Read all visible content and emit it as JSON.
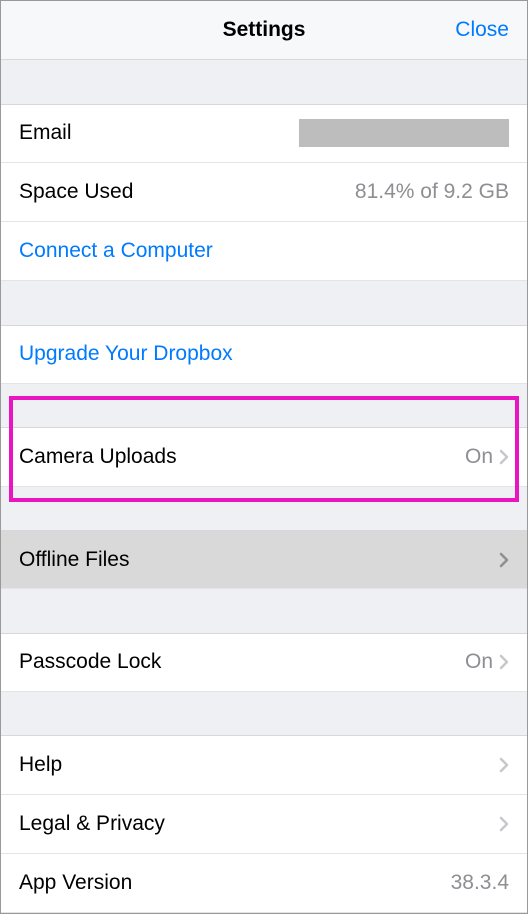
{
  "header": {
    "title": "Settings",
    "close": "Close"
  },
  "account": {
    "email_label": "Email",
    "space_used_label": "Space Used",
    "space_used_value": "81.4% of 9.2 GB",
    "connect_label": "Connect a Computer"
  },
  "upgrade": {
    "label": "Upgrade Your Dropbox"
  },
  "camera": {
    "label": "Camera Uploads",
    "value": "On"
  },
  "offline": {
    "label": "Offline Files"
  },
  "passcode": {
    "label": "Passcode Lock",
    "value": "On"
  },
  "help": {
    "label": "Help"
  },
  "legal": {
    "label": "Legal & Privacy"
  },
  "version": {
    "label": "App Version",
    "value": "38.3.4"
  }
}
